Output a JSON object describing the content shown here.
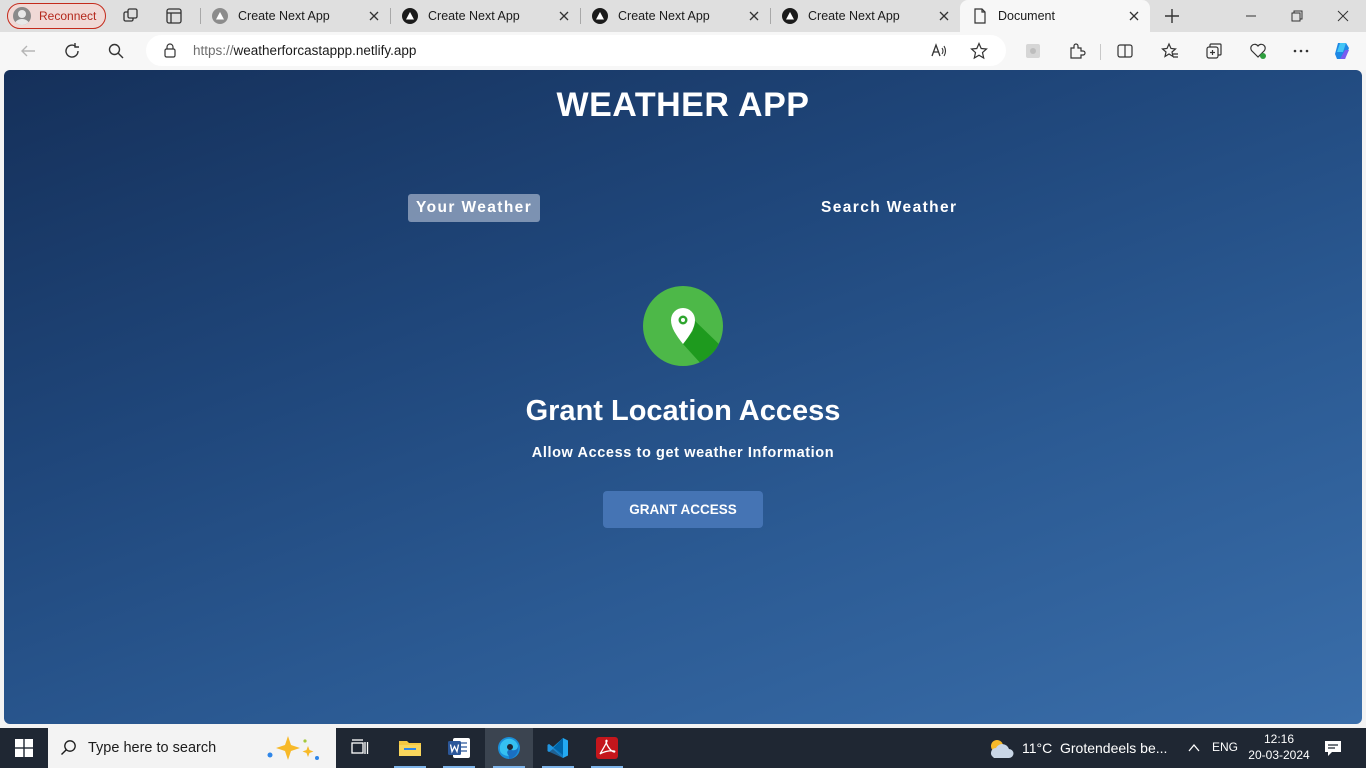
{
  "browser": {
    "profile_label": "Reconnect",
    "tabs": [
      {
        "title": "Create Next App"
      },
      {
        "title": "Create Next App"
      },
      {
        "title": "Create Next App"
      },
      {
        "title": "Create Next App"
      },
      {
        "title": "Document"
      }
    ],
    "url_prefix": "https://",
    "url_host": "weatherforcastappp.netlify.app"
  },
  "page": {
    "title": "WEATHER APP",
    "tabs": {
      "your_weather": "Your Weather",
      "search_weather": "Search Weather"
    },
    "grant": {
      "title": "Grant Location Access",
      "subtitle": "Allow Access to get weather Information",
      "button": "GRANT ACCESS"
    }
  },
  "taskbar": {
    "search_placeholder": "Type here to search",
    "weather_temp": "11°C",
    "weather_text": "Grotendeels be...",
    "language": "ENG",
    "time": "12:16",
    "date": "20-03-2024"
  },
  "colors": {
    "page_gradient_start": "#15305a",
    "page_gradient_end": "#3a6eaa",
    "grant_button": "#4574b4",
    "location_icon_green": "#4db848",
    "profile_accent": "#c42b1c"
  }
}
